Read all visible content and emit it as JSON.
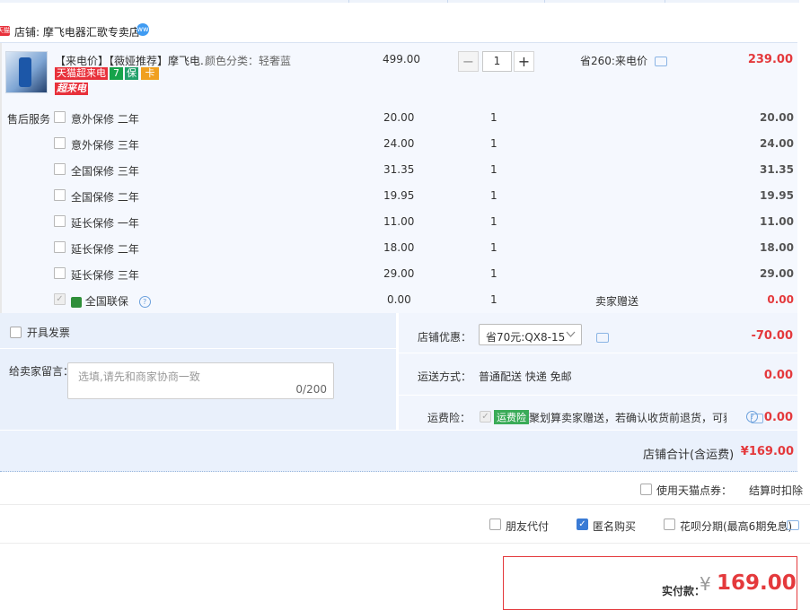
{
  "store": {
    "badge": "天猫",
    "label": "店铺: 摩飞电器汇歌专卖店",
    "ww": "ww"
  },
  "product": {
    "title": "【来电价】【薇娅推荐】摩飞电...",
    "sku": "颜色分类：轻奢蓝",
    "price": "499.00",
    "qty": "1",
    "minus": "−",
    "plus": "+",
    "discount_note": "省260:来电价",
    "subtotal": "239.00",
    "tags": [
      "天猫超来电",
      "7",
      "保",
      "卡",
      "超来电"
    ]
  },
  "services": {
    "label": "售后服务",
    "items": [
      {
        "name": "意外保修 二年",
        "price": "20.00",
        "qty": "1",
        "total": "20.00"
      },
      {
        "name": "意外保修 三年",
        "price": "24.00",
        "qty": "1",
        "total": "24.00"
      },
      {
        "name": "全国保修 三年",
        "price": "31.35",
        "qty": "1",
        "total": "31.35"
      },
      {
        "name": "全国保修 二年",
        "price": "19.95",
        "qty": "1",
        "total": "19.95"
      },
      {
        "name": "延长保修 一年",
        "price": "11.00",
        "qty": "1",
        "total": "11.00"
      },
      {
        "name": "延长保修 二年",
        "price": "18.00",
        "qty": "1",
        "total": "18.00"
      },
      {
        "name": "延长保修 三年",
        "price": "29.00",
        "qty": "1",
        "total": "29.00"
      }
    ],
    "joint": {
      "name": "全国联保",
      "price": "0.00",
      "qty": "1",
      "note": "卖家赠送",
      "total": "0.00"
    }
  },
  "invoice": {
    "label": "开具发票"
  },
  "message": {
    "label": "给卖家留言：",
    "placeholder": "选填,请先和商家协商一致",
    "counter": "0/200"
  },
  "coupon": {
    "label": "店铺优惠：",
    "selected": "省70元:QX8-15",
    "amount": "-70.00"
  },
  "shipping": {
    "label": "运送方式：",
    "value": "普通配送 快递 免邮",
    "amount": "0.00"
  },
  "insurance": {
    "label": "运费险：",
    "badge": "运费险",
    "text": "聚划算卖家赠送，若确认收货前退货，可获...",
    "amount": "0.00"
  },
  "store_total": {
    "label": "店铺合计(含运费)",
    "value": "¥169.00"
  },
  "points": {
    "label": "使用天猫点券：",
    "note": "结算时扣除"
  },
  "options": {
    "friend_pay": "朋友代付",
    "anonymous": "匿名购买",
    "huabei": "花呗分期(最高6期免息)"
  },
  "payment": {
    "label": "实付款：",
    "currency": "¥",
    "amount": "169.00"
  },
  "colors": {
    "accent_red": "#e4393c",
    "accent_blue": "#3a7bd5",
    "panel_bg": "#f5f8fe"
  }
}
